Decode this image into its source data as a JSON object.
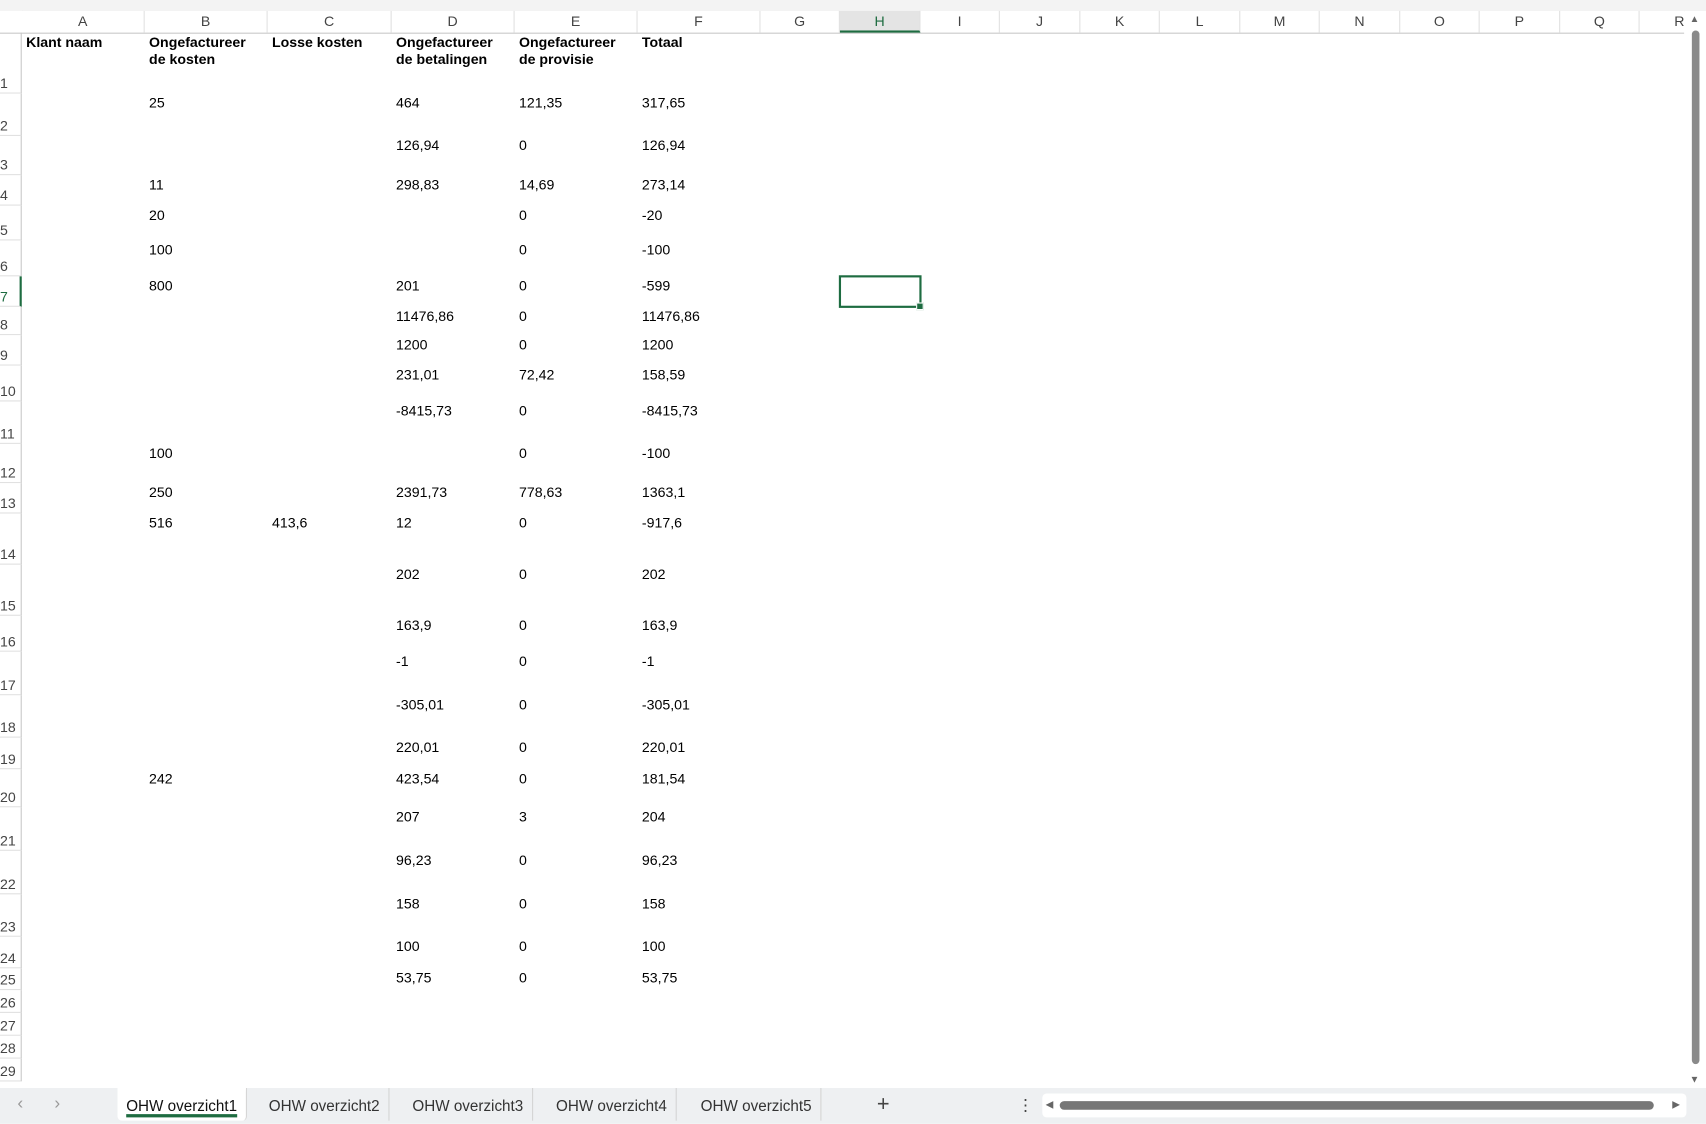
{
  "columns": [
    "A",
    "B",
    "C",
    "D",
    "E",
    "F",
    "G",
    "H",
    "I",
    "J",
    "K",
    "L",
    "M",
    "N",
    "O",
    "P",
    "Q",
    "R"
  ],
  "selected_cell": "H7",
  "header_row": [
    "Klant naam",
    "Ongefactureer\nde kosten",
    "Losse kosten",
    "Ongefactureer\nde betalingen",
    "Ongefactureer\nde provisie",
    "Totaal"
  ],
  "rows": [
    {
      "n": "2",
      "B": "25",
      "C": "",
      "D": "464",
      "E": "121,35",
      "F": "317,65"
    },
    {
      "n": "3",
      "B": "",
      "C": "",
      "D": "126,94",
      "E": "0",
      "F": "126,94"
    },
    {
      "n": "4",
      "B": "11",
      "C": "",
      "D": "298,83",
      "E": "14,69",
      "F": "273,14"
    },
    {
      "n": "5",
      "B": "20",
      "C": "",
      "D": "",
      "E": "0",
      "F": "-20"
    },
    {
      "n": "6",
      "B": "100",
      "C": "",
      "D": "",
      "E": "0",
      "F": "-100"
    },
    {
      "n": "7",
      "B": "800",
      "C": "",
      "D": "201",
      "E": "0",
      "F": "-599"
    },
    {
      "n": "8",
      "B": "",
      "C": "",
      "D": "11476,86",
      "E": "0",
      "F": "11476,86"
    },
    {
      "n": "9",
      "B": "",
      "C": "",
      "D": "1200",
      "E": "0",
      "F": "1200"
    },
    {
      "n": "10",
      "B": "",
      "C": "",
      "D": "231,01",
      "E": "72,42",
      "F": "158,59"
    },
    {
      "n": "11",
      "B": "",
      "C": "",
      "D": "-8415,73",
      "E": "0",
      "F": "-8415,73"
    },
    {
      "n": "12",
      "B": "100",
      "C": "",
      "D": "",
      "E": "0",
      "F": "-100"
    },
    {
      "n": "13",
      "B": "250",
      "C": "",
      "D": "2391,73",
      "E": "778,63",
      "F": "1363,1"
    },
    {
      "n": "14",
      "B": "516",
      "C": "413,6",
      "D": "12",
      "E": "0",
      "F": "-917,6"
    },
    {
      "n": "15",
      "B": "",
      "C": "",
      "D": "202",
      "E": "0",
      "F": "202"
    },
    {
      "n": "16",
      "B": "",
      "C": "",
      "D": "163,9",
      "E": "0",
      "F": "163,9"
    },
    {
      "n": "17",
      "B": "",
      "C": "",
      "D": "-1",
      "E": "0",
      "F": "-1"
    },
    {
      "n": "18",
      "B": "",
      "C": "",
      "D": "-305,01",
      "E": "0",
      "F": "-305,01"
    },
    {
      "n": "19",
      "B": "",
      "C": "",
      "D": "220,01",
      "E": "0",
      "F": "220,01"
    },
    {
      "n": "20",
      "B": "242",
      "C": "",
      "D": "423,54",
      "E": "0",
      "F": "181,54"
    },
    {
      "n": "21",
      "B": "",
      "C": "",
      "D": "207",
      "E": "3",
      "F": "204"
    },
    {
      "n": "22",
      "B": "",
      "C": "",
      "D": "96,23",
      "E": "0",
      "F": "96,23"
    },
    {
      "n": "23",
      "B": "",
      "C": "",
      "D": "158",
      "E": "0",
      "F": "158"
    },
    {
      "n": "24",
      "B": "",
      "C": "",
      "D": "100",
      "E": "0",
      "F": "100"
    },
    {
      "n": "25",
      "B": "",
      "C": "",
      "D": "53,75",
      "E": "0",
      "F": "53,75"
    },
    {
      "n": "26",
      "B": "",
      "C": "",
      "D": "",
      "E": "",
      "F": ""
    },
    {
      "n": "27",
      "B": "",
      "C": "",
      "D": "",
      "E": "",
      "F": ""
    },
    {
      "n": "28",
      "B": "",
      "C": "",
      "D": "",
      "E": "",
      "F": ""
    },
    {
      "n": "29",
      "B": "",
      "C": "",
      "D": "",
      "E": "",
      "F": ""
    }
  ],
  "sheet_tabs": [
    "OHW overzicht1",
    "OHW overzicht2",
    "OHW overzicht3",
    "OHW overzicht4",
    "OHW overzicht5"
  ],
  "active_tab": "OHW overzicht1",
  "icons": {
    "prev": "‹",
    "next": "›",
    "add": "+",
    "more": "⋮"
  },
  "accent_color": "#1e6c41"
}
